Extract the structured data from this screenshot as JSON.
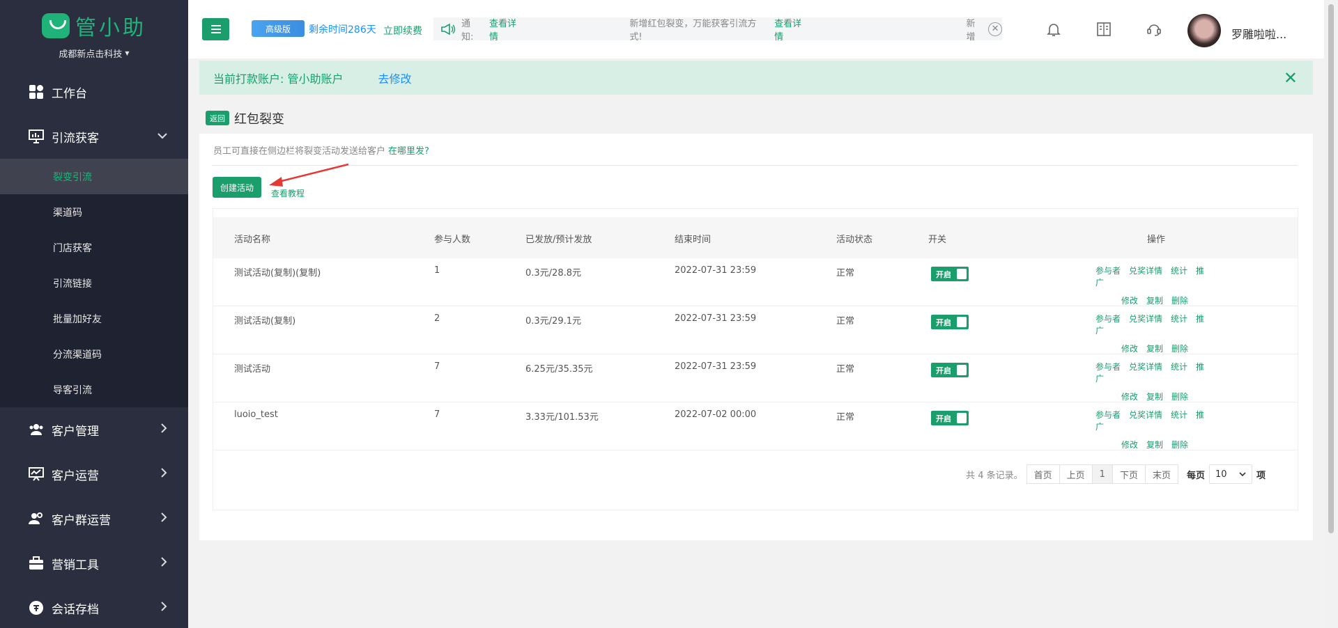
{
  "brand": {
    "name": "管小助",
    "company": "成都新点击科技"
  },
  "nav": {
    "items": [
      {
        "label": "工作台"
      },
      {
        "label": "引流获客"
      },
      {
        "label": "客户管理"
      },
      {
        "label": "客户运营"
      },
      {
        "label": "客户群运营"
      },
      {
        "label": "营销工具"
      },
      {
        "label": "会话存档"
      }
    ],
    "sub": [
      "裂变引流",
      "渠道码",
      "门店获客",
      "引流链接",
      "批量加好友",
      "分流渠道码",
      "导客引流"
    ]
  },
  "header": {
    "badge": "高级版",
    "remain": "剩余时间286天",
    "renew": "立即续费",
    "notice_label": "通知:",
    "notice_link1": "查看详情",
    "notice_msg": "新增红包裂变，万能获客引流方式!",
    "notice_link2": "查看详情",
    "notice_more": "新增",
    "user": "罗雕啦啦..."
  },
  "banner": {
    "account": "当前打款账户: 管小助账户",
    "modify": "去修改"
  },
  "page": {
    "back": "返回",
    "title": "红包裂变",
    "tip": "员工可直接在侧边栏将裂变活动发送给客户",
    "tip_link": "在哪里发?",
    "create": "创建活动",
    "tutorial": "查看教程"
  },
  "table": {
    "headers": [
      "活动名称",
      "参与人数",
      "已发放/预计发放",
      "结束时间",
      "活动状态",
      "开关",
      "操作"
    ],
    "rows": [
      {
        "name": "测试活动(复制)(复制)",
        "count": "1",
        "amount": "0.3元/28.8元",
        "end": "2022-07-31 23:59",
        "status": "正常",
        "switch": "开启"
      },
      {
        "name": "测试活动(复制)",
        "count": "2",
        "amount": "0.3元/29.1元",
        "end": "2022-07-31 23:59",
        "status": "正常",
        "switch": "开启"
      },
      {
        "name": "测试活动",
        "count": "7",
        "amount": "6.25元/35.35元",
        "end": "2022-07-31 23:59",
        "status": "正常",
        "switch": "开启"
      },
      {
        "name": "luoio_test",
        "count": "7",
        "amount": "3.33元/101.53元",
        "end": "2022-07-02 00:00",
        "status": "正常",
        "switch": "开启"
      }
    ],
    "ops1": [
      "参与者",
      "兑奖详情",
      "统计",
      "推广"
    ],
    "ops2": [
      "修改",
      "复制",
      "删除"
    ]
  },
  "pager": {
    "total": "共 4 条记录。",
    "first": "首页",
    "prev": "上页",
    "current": "1",
    "next": "下页",
    "last": "末页",
    "per": "每页",
    "size": "10",
    "unit": "项"
  },
  "colors": {
    "primary": "#1a9e6c",
    "sidebar": "#2b2e3f",
    "link": "#1890ff"
  }
}
